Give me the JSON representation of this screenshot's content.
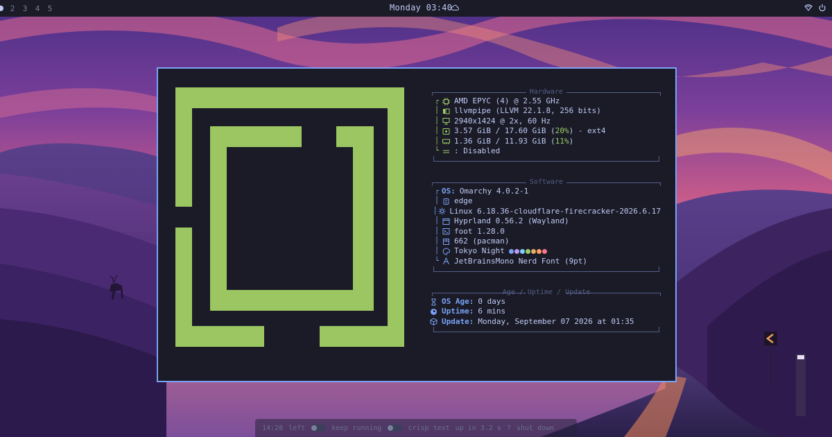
{
  "topbar": {
    "workspaces": [
      "2",
      "3",
      "4",
      "5"
    ],
    "clock": "Monday 03:40",
    "icons": [
      "cloud-icon",
      "wifi-icon",
      "power-icon"
    ]
  },
  "fastfetch": {
    "hardware": {
      "title": "Hardware",
      "cpu": "AMD EPYC (4) @ 2.55 GHz",
      "gpu": "llvmpipe (LLVM 22.1.8, 256 bits)",
      "display": "2940x1424 @ 2x, 60 Hz",
      "disk": {
        "prefix": "3.57 GiB / 17.60 GiB (",
        "pct": "20%",
        "suffix": ") - ext4"
      },
      "memory": {
        "prefix": "1.36 GiB / 11.93 GiB (",
        "pct": "11%",
        "suffix": ")"
      },
      "swap": ": Disabled"
    },
    "software": {
      "title": "Software",
      "os_label": "OS:",
      "os": "Omarchy 4.0.2-1",
      "branch": "edge",
      "kernel": "Linux 6.18.36-cloudflare-firecracker-2026.6.17",
      "wm": "Hyprland 0.56.2 (Wayland)",
      "terminal": "foot 1.28.0",
      "packages": "662 (pacman)",
      "theme": "Tokyo Night",
      "theme_colors": [
        "#7aa2f7",
        "#bb9af7",
        "#7dcfff",
        "#9ece6a",
        "#e0af68",
        "#ff9e64",
        "#f7768e"
      ],
      "font": "JetBrainsMono Nerd Font (9pt)"
    },
    "age": {
      "title": "Age / Uptime / Update",
      "os_age_label": "OS Age:",
      "os_age": "0 days",
      "uptime_label": "Uptime:",
      "uptime": "6 mins",
      "update_label": "Update:",
      "update": "Monday, September 07 2026 at 01:35"
    }
  },
  "bottombar": {
    "time": "14:28",
    "left": "left",
    "keep_running": "keep running",
    "crisp_text": "crisp text",
    "up_in": "up in 3.2 s",
    "help": "?",
    "shut_down": "shut down"
  },
  "colors": {
    "accent": "#7aa2f7",
    "logo": "#9bc662",
    "terminal_bg": "#1a1b26"
  }
}
